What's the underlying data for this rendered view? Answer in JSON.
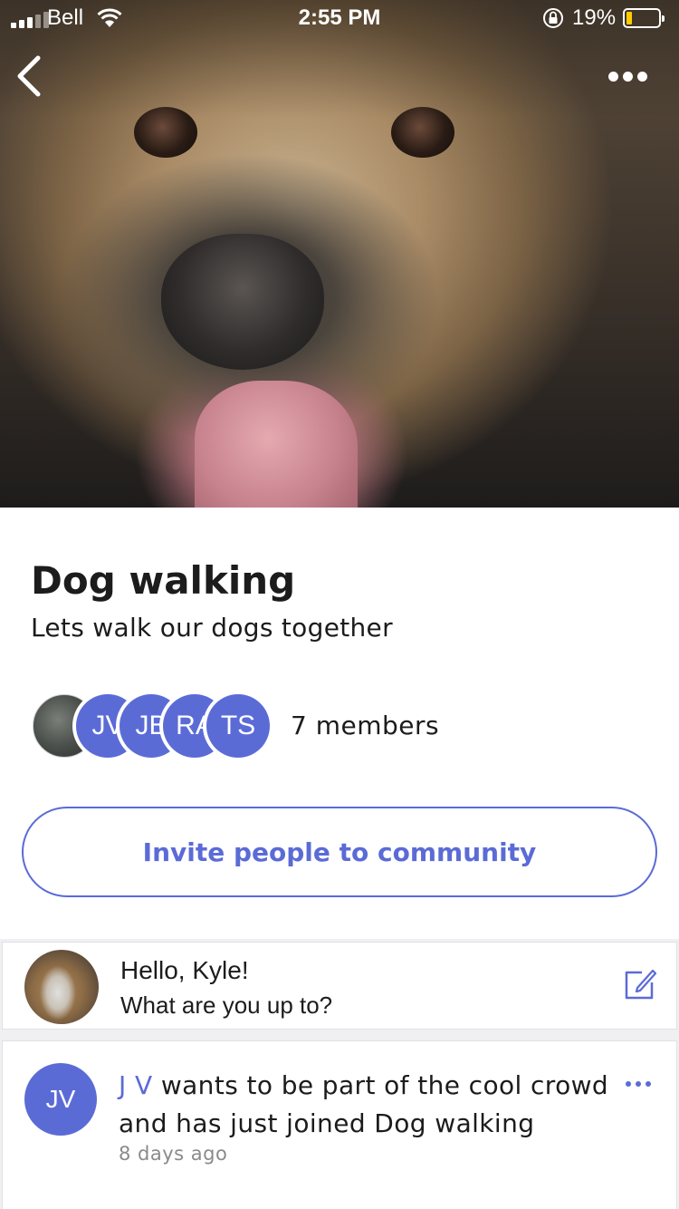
{
  "status_bar": {
    "carrier": "Bell",
    "time": "2:55 PM",
    "battery_percent": "19%",
    "battery_level": 0.19,
    "icons": [
      "signal-icon",
      "wifi-icon",
      "rotation-lock-icon",
      "battery-icon"
    ]
  },
  "header": {
    "back_icon": "chevron-left-icon",
    "more_icon": "more-horizontal-icon"
  },
  "community": {
    "title": "Dog walking",
    "description": "Lets walk our dogs together",
    "member_avatars": [
      {
        "initials": "",
        "type": "photo"
      },
      {
        "initials": "JV",
        "type": "initials"
      },
      {
        "initials": "JB",
        "type": "initials"
      },
      {
        "initials": "RA",
        "type": "initials"
      },
      {
        "initials": "TS",
        "type": "initials"
      }
    ],
    "members_label": "7 members",
    "invite_label": "Invite people to community"
  },
  "compose": {
    "greeting": "Hello, Kyle!",
    "prompt": "What are you up to?",
    "icon": "edit-icon"
  },
  "feed": [
    {
      "avatar_initials": "JV",
      "user": "J V",
      "message": " wants to be part of the cool crowd and has just joined Dog walking",
      "time": "8 days ago"
    }
  ],
  "colors": {
    "accent": "#5b6bd6",
    "text": "#1c1c1c",
    "muted": "#8a8a8a",
    "background_gray": "#f0f0f2"
  }
}
